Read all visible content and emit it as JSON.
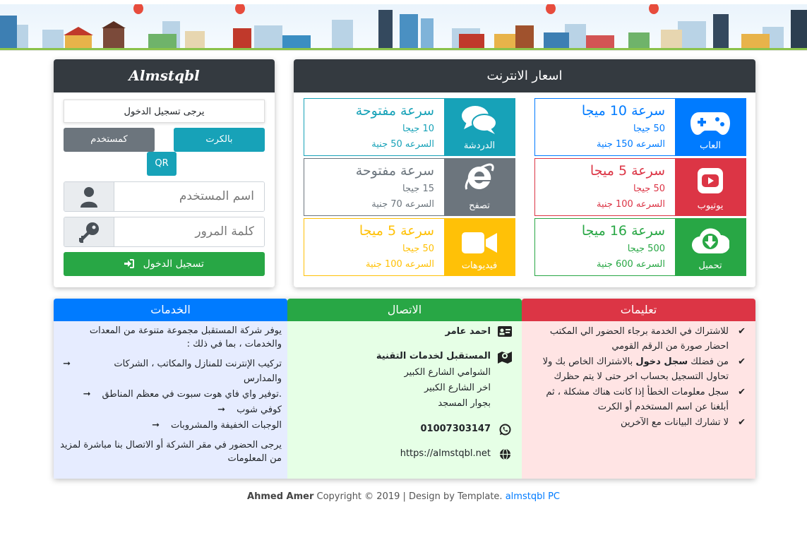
{
  "brand": "Almstqbl",
  "login": {
    "notice": "يرجى تسجيل الدخول",
    "card_button": "بالكرت",
    "user_button": "كمستخدم",
    "qr_button": "QR",
    "username_placeholder": "اسم المستخدم",
    "password_placeholder": "كلمة المرور",
    "login_button": "تسجيل الدخول"
  },
  "prices": {
    "title": "اسعار الانترنت",
    "tiles": [
      {
        "label": "العاب",
        "speed": "سرعة 10 ميجا",
        "quota": "50 جيجا",
        "price": "السرعه 150 جنية",
        "color": "#007bff",
        "icon": "gamepad-icon"
      },
      {
        "label": "الدردشة",
        "speed": "سرعة مفتوحة",
        "quota": "10 جيجا",
        "price": "السرعه 50 جنية",
        "color": "#17a2b8",
        "icon": "chat-icon"
      },
      {
        "label": "يوتيوب",
        "speed": "سرعة 5 ميجا",
        "quota": "50 جيجا",
        "price": "السرعه 100 جنية",
        "color": "#dc3545",
        "icon": "youtube-icon"
      },
      {
        "label": "تصفح",
        "speed": "سرعة مفتوحة",
        "quota": "15 جيجا",
        "price": "السرعه 70 جنية",
        "color": "#6c757d",
        "icon": "browser-icon"
      },
      {
        "label": "تحميل",
        "speed": "سرعة 16 ميجا",
        "quota": "500 جيجا",
        "price": "السرعه 600 جنية",
        "color": "#28a745",
        "icon": "cloud-download-icon"
      },
      {
        "label": "فيديوهات",
        "speed": "سرعة 5 ميجا",
        "quota": "50 جيجا",
        "price": "السرعه 100 جنية",
        "color": "#ffc107",
        "icon": "video-camera-icon"
      }
    ]
  },
  "instructions": {
    "title": "تعليمات",
    "items": [
      "للاشتراك في الخدمة برجاء الحضور الي المكتب احضار صورة من الرقم القومي",
      {
        "before": "من فضلك ",
        "bold": "سجل دخول",
        "after": " بالاشتراك الخاص بك ولا تحاول التسجيل بحساب اخر حتى لا يتم حظرك"
      },
      "سجل معلومات الخطأ إذا كانت هناك مشكلة ، ثم أبلغنا عن اسم المستخدم أو الكرت",
      "لا تشارك البيانات مع الآخرين"
    ]
  },
  "contact": {
    "title": "الاتصال",
    "name": "احمد عامر",
    "company": "المستقبل لخدمات التقنية",
    "address": [
      "الشوامي الشارع الكبير",
      "اخر الشارع الكبير",
      "بجوار المسجد"
    ],
    "phone": "01007303147",
    "website": "https://almstqbl.net"
  },
  "services": {
    "title": "الخدمات",
    "intro": "يوفر شركة المستقبل مجموعة متنوعة من المعدات والخدمات ، بما في ذلك :",
    "items": [
      "تركيب الإنترنت للمنازل والمكاتب ، الشركات والمدارس",
      ".توفير واي فاي هوت سبوت في معظم المناطق",
      "كوفي شوب",
      "الوجبات الخفيفة والمشروبات"
    ],
    "outro": "يرجى الحضور في مقر الشركة أو الاتصال بنا مباشرة لمزيد من المعلومات"
  },
  "footer": {
    "author": "Ahmed Amer",
    "text": " Copyright © 2019 | Design by Template. ",
    "link": "almstqbl PC"
  }
}
